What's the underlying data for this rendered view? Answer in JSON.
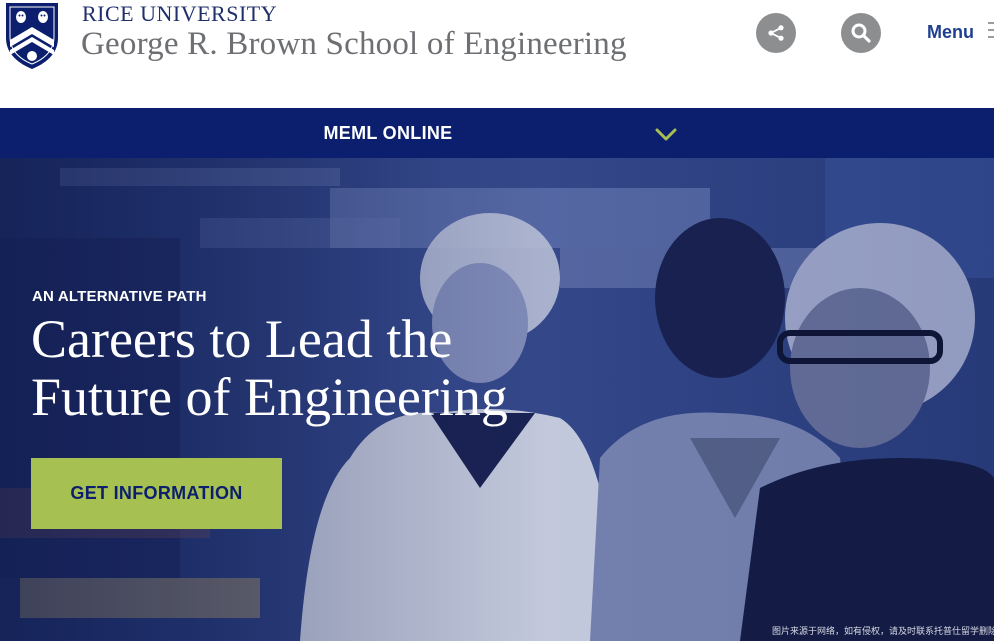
{
  "header": {
    "university": "RICE UNIVERSITY",
    "school": "George R. Brown School of Engineering",
    "share_icon": "share-icon",
    "search_icon": "search-icon",
    "menu_label": "Menu",
    "menu_icon": "hamburger-icon"
  },
  "subnav": {
    "label": "MEML ONLINE",
    "chevron_icon": "chevron-down-icon"
  },
  "hero": {
    "eyebrow": "AN ALTERNATIVE PATH",
    "headline_line1": "Careers to Lead the",
    "headline_line2": "Future of Engineering",
    "cta_label": "GET INFORMATION",
    "image_caption": "图片来源于网络，如有侵权，请及时联系托普仕留学删除"
  },
  "colors": {
    "navy": "#0b1f6e",
    "accent_green": "#a6c052",
    "link_blue": "#1f3f8f",
    "gray_text": "#6d6f73",
    "icon_gray": "#8d8e90"
  }
}
